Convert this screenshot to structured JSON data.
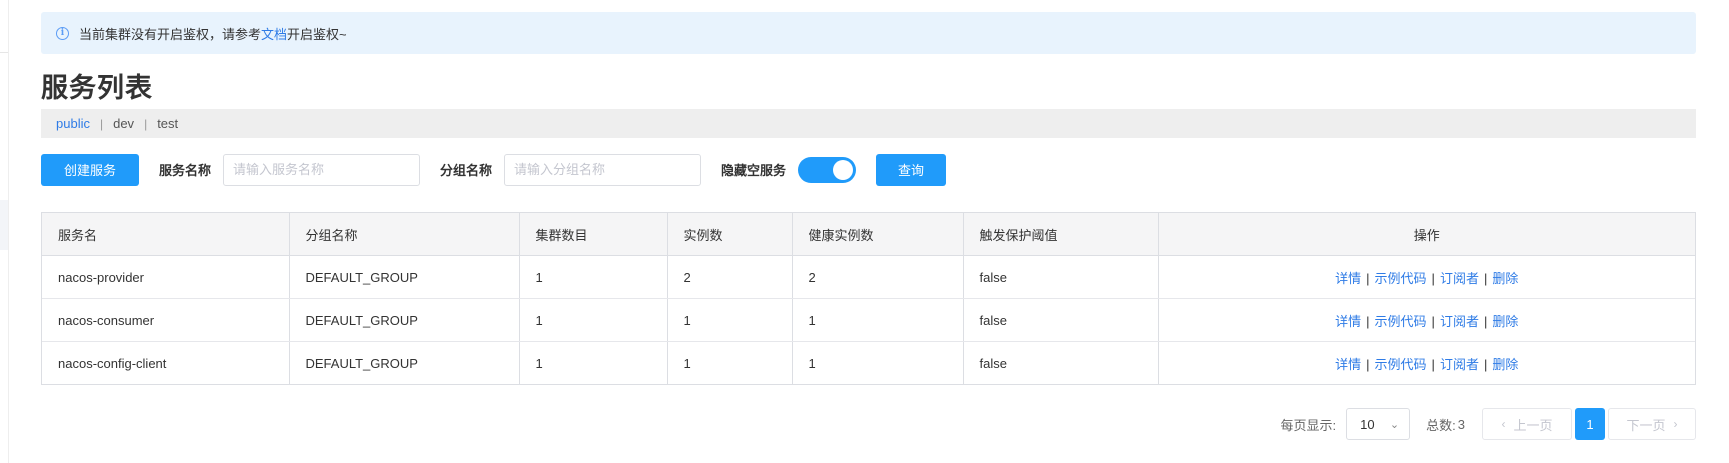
{
  "alert": {
    "prefix": "当前集群没有开启鉴权，请参考",
    "link": "文档",
    "suffix": "开启鉴权~",
    "icon": "info-icon"
  },
  "page_title": "服务列表",
  "namespaces": {
    "items": [
      "public",
      "dev",
      "test"
    ],
    "active": "public",
    "separator": "|"
  },
  "toolbar": {
    "create_label": "创建服务",
    "service_name_label": "服务名称",
    "service_name_placeholder": "请输入服务名称",
    "service_name_value": "",
    "group_name_label": "分组名称",
    "group_name_placeholder": "请输入分组名称",
    "group_name_value": "",
    "hide_empty_label": "隐藏空服务",
    "hide_empty_on": true,
    "query_label": "查询"
  },
  "table": {
    "headers": [
      "服务名",
      "分组名称",
      "集群数目",
      "实例数",
      "健康实例数",
      "触发保护阈值",
      "操作"
    ],
    "rows": [
      [
        "nacos-provider",
        "DEFAULT_GROUP",
        "1",
        "2",
        "2",
        "false"
      ],
      [
        "nacos-consumer",
        "DEFAULT_GROUP",
        "1",
        "1",
        "1",
        "false"
      ],
      [
        "nacos-config-client",
        "DEFAULT_GROUP",
        "1",
        "1",
        "1",
        "false"
      ]
    ],
    "operations": [
      "详情",
      "示例代码",
      "订阅者",
      "删除"
    ],
    "op_separator": "|"
  },
  "pagination": {
    "page_size_label": "每页显示:",
    "page_size": "10",
    "total_label": "总数:",
    "total": "3",
    "prev_label": "上一页",
    "next_label": "下一页",
    "current_page": "1"
  },
  "colors": {
    "primary": "#209bfa",
    "link": "#2e7be6",
    "alert_bg": "#e8f3fd"
  }
}
